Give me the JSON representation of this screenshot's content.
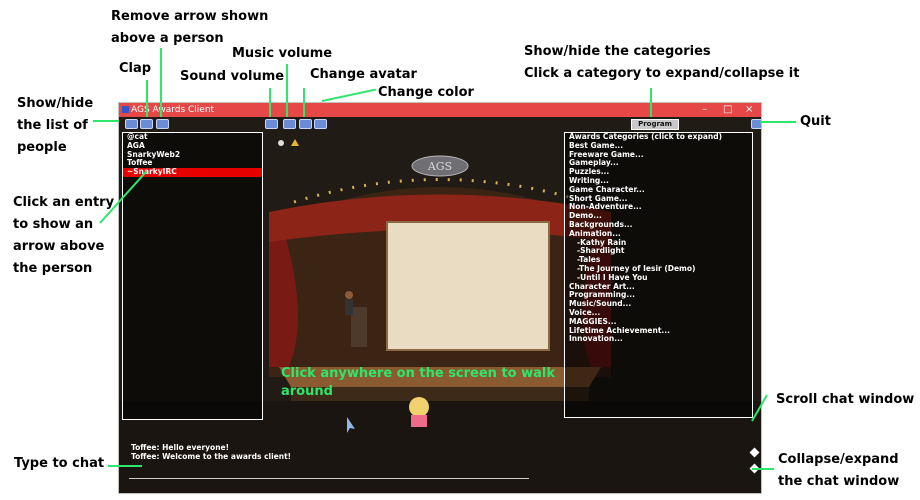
{
  "window": {
    "title": "AGS Awards Client",
    "controls": [
      "–",
      "□",
      "×"
    ]
  },
  "toolbar": {
    "people_button_icon": "people-icon",
    "clap_button_icon": "clap-icon",
    "remove_arrow_button_icon": "arrow-remove-icon",
    "sound_volume_icon": "sound-icon",
    "music_volume_icon": "music-icon",
    "avatar_icon": "avatar-icon",
    "color_icon": "color-icon",
    "program_label": "Program",
    "quit_icon": "quit-icon"
  },
  "people": {
    "items": [
      "@cat",
      "AGA",
      "SnarkyWeb2",
      "Toffee",
      "~SnarkyIRC"
    ],
    "selected_index": 4
  },
  "categories": {
    "header": "Awards Categories (click to expand)",
    "items": [
      "Best Game...",
      "Freeware Game...",
      "Gameplay...",
      "Puzzles...",
      "Writing...",
      "Game Character...",
      "Short Game...",
      "Non-Adventure...",
      "Demo...",
      "Backgrounds...",
      "Animation...",
      " -Kathy Rain",
      " -Shardlight",
      " -Tales",
      " -The Journey of Iesir (Demo)",
      " -Until I Have You",
      "Character Art...",
      "Programming...",
      "Music/Sound...",
      "Voice...",
      "MAGGIES...",
      "Lifetime Achievement...",
      "Innovation..."
    ]
  },
  "chat": {
    "lines": [
      "Toffee: Hello everyone!",
      "Toffee: Welcome to the awards client!"
    ],
    "input_value": ""
  },
  "scene": {
    "sign": "AGS"
  },
  "annotations": {
    "show_hide_people": [
      "Show/hide",
      "the list of",
      "people"
    ],
    "clap": "Clap",
    "remove_arrow": [
      "Remove arrow shown",
      "above a person"
    ],
    "sound_volume": "Sound volume",
    "music_volume": "Music volume",
    "change_avatar": "Change avatar",
    "change_color": "Change color",
    "categories": [
      "Show/hide the categories",
      "Click a category to expand/collapse it"
    ],
    "quit": "Quit",
    "click_entry": [
      "Click an entry",
      "to show an",
      "arrow above",
      "the person"
    ],
    "walk": [
      "Click anywhere on the screen to walk",
      "around"
    ],
    "scroll_chat": "Scroll chat window",
    "type_chat": "Type to chat",
    "collapse_chat": [
      "Collapse/expand",
      "the chat window"
    ]
  },
  "colors": {
    "titlebar": "#e64848",
    "annotation_arrow": "#2ee66b",
    "selected_row": "#e60000",
    "button": "#6c8bd6"
  }
}
